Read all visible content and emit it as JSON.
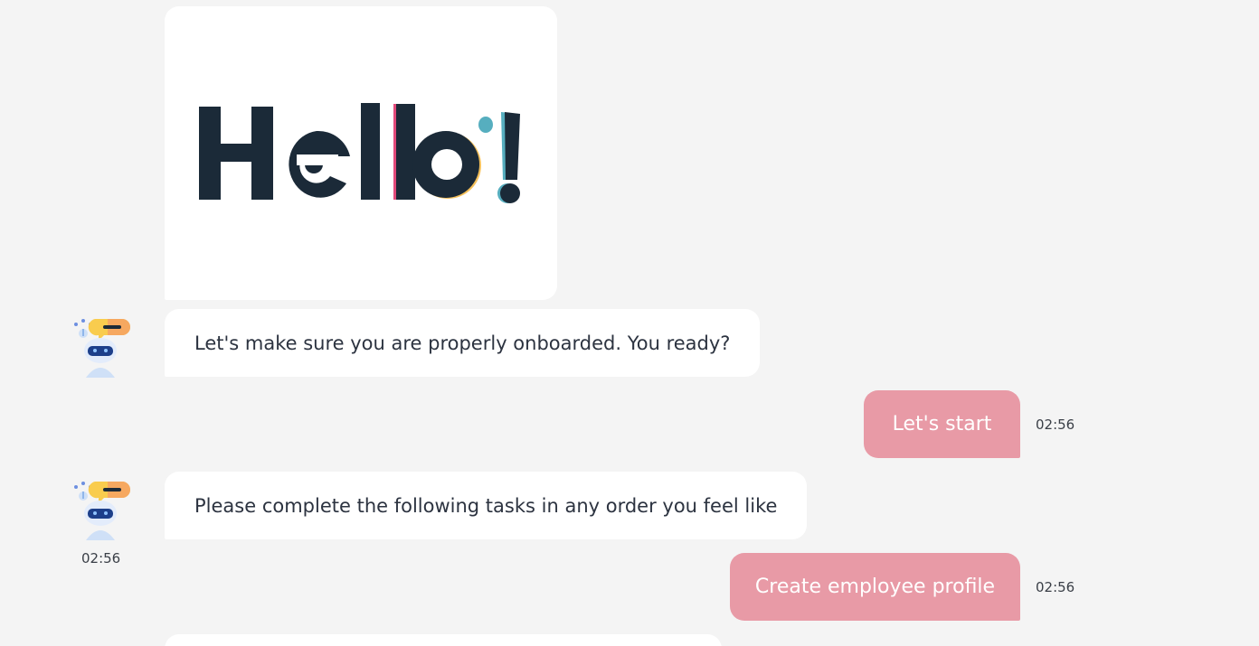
{
  "greeting_image": {
    "text": "Hello!",
    "colors": {
      "letters": "#1b2a38",
      "accent_pink": "#e24a7a",
      "accent_teal": "#56aebf",
      "accent_yellow": "#f5c05a"
    }
  },
  "messages": [
    {
      "sender": "bot",
      "text": "Let's make sure you are properly onboarded. You ready?"
    },
    {
      "sender": "user",
      "text": "Let's start",
      "time": "02:56"
    },
    {
      "sender": "bot",
      "text": "Please complete the following tasks in any order you feel like",
      "time": "02:56"
    },
    {
      "sender": "user",
      "text": "Create employee profile",
      "time": "02:56"
    }
  ],
  "colors": {
    "background": "#f4f4f4",
    "user_bubble": "#e89aa6",
    "bot_bubble": "#ffffff",
    "bot_text": "#2c3340"
  },
  "icons": {
    "bot_avatar": "robot-avatar-icon"
  }
}
